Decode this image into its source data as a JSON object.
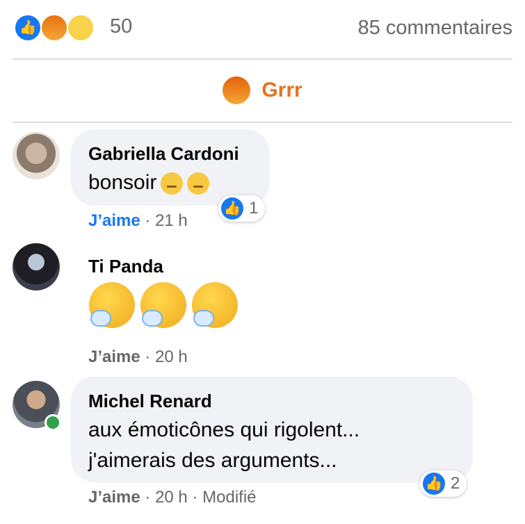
{
  "summary": {
    "reaction_count": "50",
    "comments_count": "85 commentaires",
    "reactions": [
      "like-icon",
      "angry-icon",
      "sad-icon"
    ]
  },
  "filter": {
    "label": "Grrr",
    "icon": "angry-icon",
    "color": "#e4721f"
  },
  "comments": [
    {
      "author": "Gabriella Cardoni",
      "text": "bonsoir",
      "emojis": [
        "pensive-icon",
        "relieved-icon"
      ],
      "like_label": "J’aime",
      "time": "21 h",
      "liked": true,
      "reaction_count": "1"
    },
    {
      "author": "Ti Panda",
      "emojis": [
        "thinking-face-icon",
        "thinking-face-icon",
        "thinking-face-icon"
      ],
      "like_label": "J’aime",
      "time": "20 h"
    },
    {
      "author": "Michel Renard",
      "text_line1": "aux émoticônes qui rigolent...",
      "text_line2": "j'aimerais des arguments...",
      "like_label": "J’aime",
      "time": "20 h",
      "edited": "Modifié",
      "reaction_count": "2",
      "online": true
    }
  ],
  "colors": {
    "link_blue": "#1877f2",
    "meta_gray": "#65676b",
    "bubble_bg": "#f0f2f5"
  },
  "separator": "·"
}
